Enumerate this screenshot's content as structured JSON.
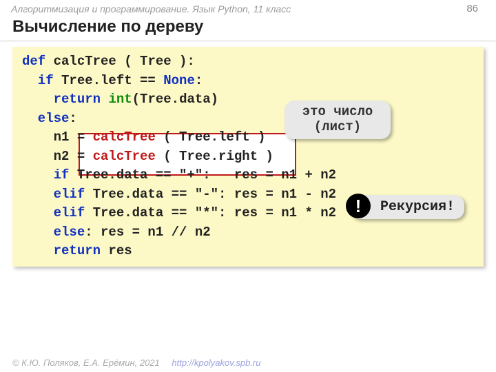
{
  "header": {
    "breadcrumb": "Алгоритмизация и программирование. Язык Python, 11 класс",
    "page": "86"
  },
  "title": "Вычисление по дереву",
  "code": {
    "l1_def": "def",
    "l1_name": " calcTree ( Tree ):",
    "l2_if": "  if",
    "l2_body": " Tree.left == ",
    "l2_none": "None",
    "l2_colon": ":",
    "l3_pad": "    ",
    "l3_ret": "return",
    "l3_sp": " ",
    "l3_int": "int",
    "l3_tail": "(Tree.data)",
    "l4_else": "  else",
    "l4_colon": ":",
    "l5_pre": "    n1 = ",
    "l5_call": "calcTree",
    "l5_tail": " ( Tree.left )",
    "l6_pre": "    n2 = ",
    "l6_call": "calcTree",
    "l6_tail": " ( Tree.right )",
    "l7_if": "    if",
    "l7_body": " Tree.data == \"+\":   res = n1 + n2",
    "l8_elif": "    elif",
    "l8_body": " Tree.data == \"-\": res = n1 - n2",
    "l9_elif": "    elif",
    "l9_body": " Tree.data == \"*\": res = n1 * n2",
    "l10_else": "    else",
    "l10_body": ": res = n1 // n2",
    "l11_pad": "    ",
    "l11_ret": "return",
    "l11_body": " res"
  },
  "callouts": {
    "leaf": "это число (лист)",
    "recursion": "Рекурсия!",
    "bang": "!"
  },
  "footer": {
    "copyright": "© К.Ю. Поляков, Е.А. Ерёмин, 2021",
    "url": "http://kpolyakov.spb.ru"
  }
}
